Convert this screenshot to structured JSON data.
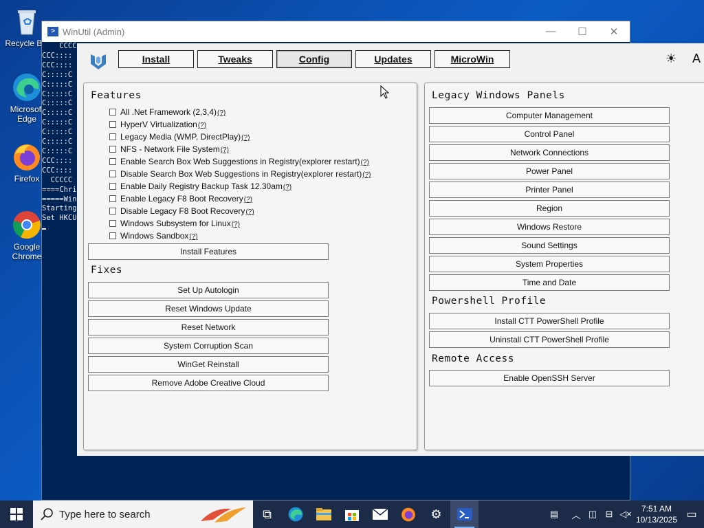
{
  "desktop": {
    "icons": [
      {
        "label": "Recycle Bin"
      },
      {
        "label": "Microsoft Edge"
      },
      {
        "label": "Firefox"
      },
      {
        "label": "Google Chrome"
      }
    ]
  },
  "console": {
    "title": "WinUtil (Admin)",
    "lines": [
      "    CCCC",
      "CCC::::",
      "CCC::::",
      "C:::::C",
      "C:::::C",
      "C:::::C",
      "C:::::C",
      "C:::::C",
      "C:::::C",
      "C:::::C",
      "C:::::C",
      "C:::::C",
      "CCC::::",
      "CCC::::",
      "  CCCCC",
      "",
      "====Chri",
      "=====Win",
      "Starting",
      "Set HKCU"
    ]
  },
  "winutil": {
    "tabs": [
      {
        "label": "Install"
      },
      {
        "label": "Tweaks"
      },
      {
        "label": "Config"
      },
      {
        "label": "Updates"
      },
      {
        "label": "MicroWin"
      }
    ],
    "theme_icon": "☀",
    "font_icon": "A",
    "features": {
      "title": "Features",
      "help_marker": "(?)",
      "items": [
        "All .Net Framework (2,3,4)",
        "HyperV Virtualization",
        "Legacy Media (WMP, DirectPlay)",
        "NFS - Network File System",
        "Enable Search Box Web Suggestions in Registry(explorer restart)",
        "Disable Search Box Web Suggestions in Registry(explorer restart)",
        "Enable Daily Registry Backup Task 12.30am",
        "Enable Legacy F8 Boot Recovery",
        "Disable Legacy F8 Boot Recovery",
        "Windows Subsystem for Linux",
        "Windows Sandbox"
      ],
      "install_button": "Install Features"
    },
    "fixes": {
      "title": "Fixes",
      "buttons": [
        "Set Up Autologin",
        "Reset Windows Update",
        "Reset Network",
        "System Corruption Scan",
        "WinGet Reinstall",
        "Remove Adobe Creative Cloud"
      ]
    },
    "legacy_panels": {
      "title": "Legacy Windows Panels",
      "buttons": [
        "Computer Management",
        "Control Panel",
        "Network Connections",
        "Power Panel",
        "Printer Panel",
        "Region",
        "Windows Restore",
        "Sound Settings",
        "System Properties",
        "Time and Date"
      ]
    },
    "powershell_profile": {
      "title": "Powershell Profile",
      "buttons": [
        "Install CTT PowerShell Profile",
        "Uninstall CTT PowerShell Profile"
      ]
    },
    "remote_access": {
      "title": "Remote Access",
      "buttons": [
        "Enable OpenSSH Server"
      ]
    }
  },
  "taskbar": {
    "search_placeholder": "Type here to search",
    "time": "7:51 AM",
    "date": "10/13/2025"
  },
  "colors": {
    "desktop": "#0b5cc4",
    "taskbar": "#1c2b48",
    "console_bg": "#012456",
    "winutil_bg": "#f1f1f1"
  }
}
